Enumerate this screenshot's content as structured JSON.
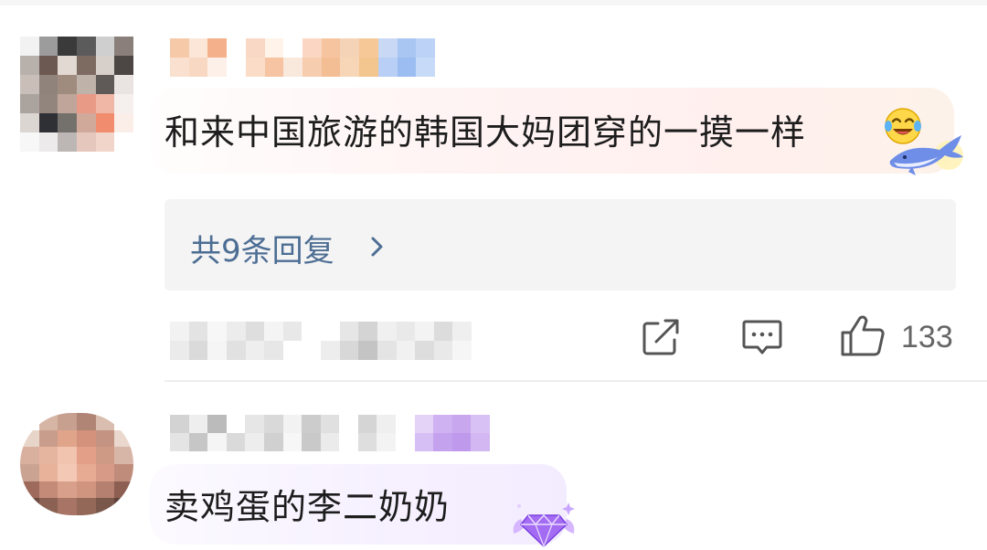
{
  "comments": [
    {
      "text": "和来中国旅游的韩国大妈团穿的一摸一样",
      "replies_label": "共9条回复",
      "like_count": "133",
      "badge": "whale-badge",
      "emoji": "laughing-crying-emoji"
    },
    {
      "text": "卖鸡蛋的李二奶奶",
      "badge": "gem-badge"
    }
  ],
  "colors": {
    "reply_link": "#4d6e94",
    "bubble_1": "#fff1ef",
    "bubble_2": "#f5efff",
    "action_icon": "#555555"
  },
  "icons": {
    "share": "share-icon",
    "reply": "comment-icon",
    "like": "thumbs-up-icon",
    "chevron": "chevron-right-icon"
  }
}
